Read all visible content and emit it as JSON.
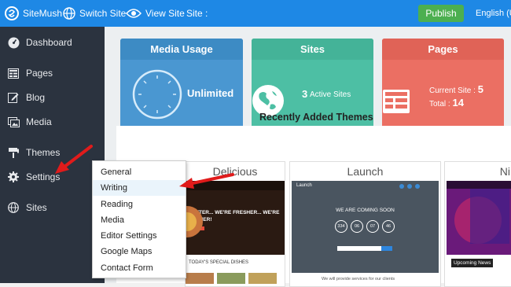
{
  "topbar": {
    "brand": "SiteMush",
    "switch_site": "Switch Site",
    "view_site": "View Site",
    "site_label": "Site :",
    "publish": "Publish",
    "language": "English (U",
    "colors": {
      "bar": "#1e88e5",
      "publish": "#4caf50"
    }
  },
  "sidebar": {
    "items": [
      {
        "label": "Dashboard",
        "icon": "dashboard-icon"
      },
      {
        "label": "Pages",
        "icon": "pages-icon"
      },
      {
        "label": "Blog",
        "icon": "blog-icon"
      },
      {
        "label": "Media",
        "icon": "media-icon"
      },
      {
        "label": "Themes",
        "icon": "themes-icon"
      },
      {
        "label": "Settings",
        "icon": "gear-icon"
      },
      {
        "label": "Sites",
        "icon": "globe-icon"
      }
    ]
  },
  "cards": {
    "media": {
      "title": "Media Usage",
      "value": "Unlimited",
      "color": "#4a97d1"
    },
    "sites": {
      "title": "Sites",
      "count": "3",
      "label": "Active Sites",
      "color": "#4dbfa4"
    },
    "pages": {
      "title": "Pages",
      "current_label": "Current Site :",
      "current_value": "5",
      "total_label": "Total :",
      "total_value": "14",
      "color": "#eb6f63"
    }
  },
  "recent": {
    "title": "Recently Added Themes",
    "themes": [
      {
        "name": "Delicious",
        "banner": "BETTER... WE'RE FRESHER... WE'RE TASTIER!",
        "sub": "TODAY'S SPECIAL DISHES"
      },
      {
        "name": "Launch",
        "header": "Launch",
        "banner": "WE ARE COMING SOON",
        "counters": [
          "334",
          "06",
          "07",
          "46"
        ],
        "sub": "We will provide services for our clients"
      },
      {
        "name": "Ni",
        "sub": "Upcoming News"
      }
    ]
  },
  "settings_menu": {
    "items": [
      "General",
      "Writing",
      "Reading",
      "Media",
      "Editor Settings",
      "Google Maps",
      "Contact Form"
    ],
    "highlighted": "Writing"
  }
}
